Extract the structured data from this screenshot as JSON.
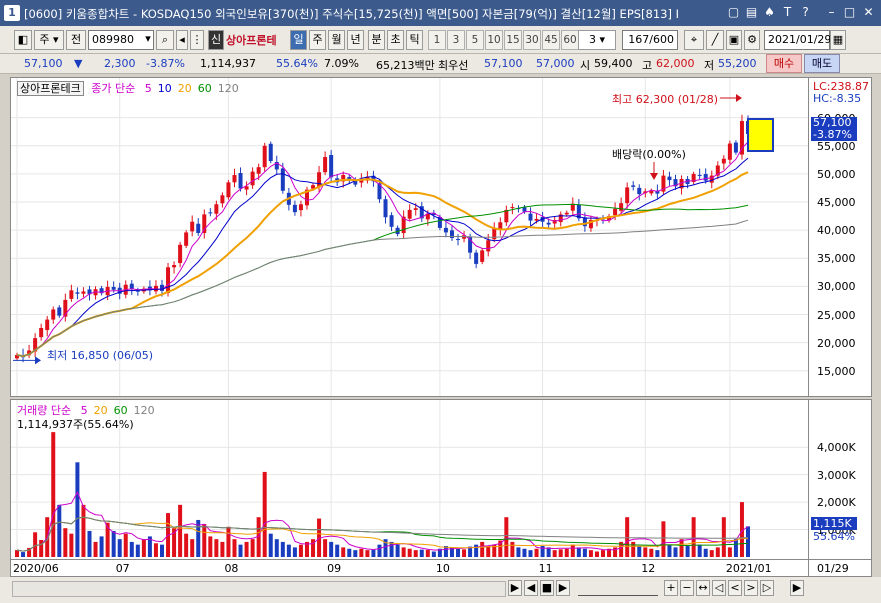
{
  "window": {
    "number": "1",
    "title": "[0600] 키움종합차트 - KOSDAQ150 외국인보유[370(천)] 주식수[15,725(천)] 액면[500] 자본금[79(억)] 결산[12월] EPS[813] I"
  },
  "toolbar": {
    "period_label": "주",
    "prev_label": "전",
    "code": "089980",
    "credit_label": "신",
    "stock_name": "상아프론테",
    "period_tabs": [
      "일",
      "주",
      "월",
      "년",
      "분",
      "초",
      "틱"
    ],
    "minute_options": [
      "1",
      "3",
      "5",
      "10",
      "15",
      "30",
      "45",
      "60"
    ],
    "interval_value": "3",
    "count": "167/600",
    "date": "2021/01/29"
  },
  "quote": {
    "price": "57,100",
    "direction": "▼",
    "change": "2,300",
    "change_pct": "-3.87%",
    "volume": "1,114,937",
    "volume_ratio": "55.64%",
    "turnover": "7.09%",
    "amount": "65,213백만",
    "best_label": "최우선",
    "best_ask": "57,100",
    "best_bid": "57,000",
    "open_label": "시",
    "open": "59,400",
    "high_label": "고",
    "high": "62,000",
    "low_label": "저",
    "low": "55,200",
    "buy_label": "매수",
    "sell_label": "매도"
  },
  "price_panel": {
    "name_tag": "상아프론테크",
    "legend_prefix": "종가 단순",
    "ma_periods": [
      "5",
      "10",
      "20",
      "60",
      "120"
    ],
    "ma_colors": [
      "#cc00cc",
      "#0000cc",
      "#f0a000",
      "#009000",
      "#808080"
    ],
    "lc": "LC:238.87",
    "hc": "HC:-8.35",
    "high_annotation": "최고 62,300 (01/28)",
    "low_annotation": "최저 16,850 (06/05)",
    "dividend_annotation": "배당락(0.00%)",
    "current_price_tag": "57,100",
    "current_pct_tag": "-3.87%",
    "y_ticks": [
      "60,000",
      "55,000",
      "50,000",
      "45,000",
      "40,000",
      "35,000",
      "30,000",
      "25,000",
      "20,000",
      "15,000"
    ]
  },
  "volume_panel": {
    "legend_prefix": "거래량 단순",
    "ma_periods": [
      "5",
      "20",
      "60",
      "120"
    ],
    "ma_colors": [
      "#cc00cc",
      "#f0a000",
      "#009000",
      "#808080"
    ],
    "value_line": "1,114,937주(55.64%)",
    "current_tag": "1,115K",
    "current_pct_tag": "55.64%",
    "y_ticks": [
      "4,000K",
      "3,000K",
      "2,000K",
      "1,000K"
    ]
  },
  "x_axis": {
    "labels": [
      "2020/06",
      "07",
      "08",
      "09",
      "10",
      "11",
      "12",
      "2021/01"
    ],
    "right_label": "01/29"
  },
  "chart_data": {
    "type": "candlestick",
    "title": "상아프론테크",
    "y_range": [
      13000,
      63500
    ],
    "volume_range": [
      0,
      4700000
    ],
    "high": 62300,
    "low": 16850,
    "last_close": 57100,
    "closes": [
      17800,
      17400,
      18600,
      20800,
      22600,
      24100,
      25900,
      24800,
      27600,
      29300,
      28700,
      29100,
      28600,
      29500,
      28800,
      29900,
      29400,
      28700,
      30300,
      29600,
      29100,
      29600,
      29300,
      30100,
      29200,
      33400,
      33800,
      37400,
      39600,
      41500,
      39500,
      42800,
      43100,
      44600,
      46200,
      48500,
      49800,
      47400,
      47800,
      50400,
      51200,
      55000,
      52300,
      50800,
      47000,
      44500,
      43200,
      44600,
      47200,
      48000,
      50300,
      53000,
      49400,
      48500,
      49800,
      49000,
      48100,
      49000,
      49500,
      48700,
      45500,
      42300,
      40600,
      39300,
      42400,
      43600,
      43900,
      42100,
      42900,
      42700,
      40400,
      39600,
      38600,
      38300,
      39100,
      36000,
      34000,
      36400,
      38200,
      40400,
      41400,
      43600,
      44100,
      43900,
      43300,
      41700,
      42000,
      41500,
      41000,
      41800,
      42800,
      43100,
      44700,
      42100,
      40700,
      41800,
      41800,
      41900,
      42500,
      43800,
      44800,
      47600,
      47700,
      46400,
      46900,
      47000,
      46500,
      49700,
      48900,
      47800,
      49100,
      48200,
      50000,
      49800,
      48800,
      49700,
      51500,
      52700,
      55400,
      53800,
      59400,
      57100
    ],
    "volumes": [
      250000,
      180000,
      330000,
      900000,
      620000,
      1450000,
      4550000,
      1900000,
      1050000,
      850000,
      3450000,
      1900000,
      950000,
      550000,
      750000,
      1250000,
      950000,
      650000,
      850000,
      550000,
      450000,
      650000,
      750000,
      500000,
      450000,
      1600000,
      1050000,
      1900000,
      850000,
      650000,
      1350000,
      1200000,
      750000,
      650000,
      550000,
      1100000,
      650000,
      450000,
      550000,
      650000,
      1450000,
      3100000,
      850000,
      650000,
      550000,
      450000,
      350000,
      450000,
      550000,
      650000,
      1400000,
      650000,
      550000,
      450000,
      350000,
      300000,
      250000,
      300000,
      250000,
      260000,
      450000,
      650000,
      550000,
      450000,
      350000,
      300000,
      250000,
      270000,
      260000,
      200000,
      300000,
      400000,
      350000,
      300000,
      280000,
      380000,
      450000,
      550000,
      400000,
      450000,
      600000,
      1450000,
      550000,
      350000,
      300000,
      250000,
      300000,
      400000,
      350000,
      250000,
      280000,
      300000,
      450000,
      350000,
      300000,
      250000,
      200000,
      250000,
      300000,
      350000,
      550000,
      1450000,
      550000,
      400000,
      350000,
      300000,
      250000,
      1300000,
      450000,
      350000,
      650000,
      400000,
      1450000,
      450000,
      300000,
      250000,
      350000,
      1450000,
      350000,
      650000,
      2000000,
      1115000
    ]
  }
}
